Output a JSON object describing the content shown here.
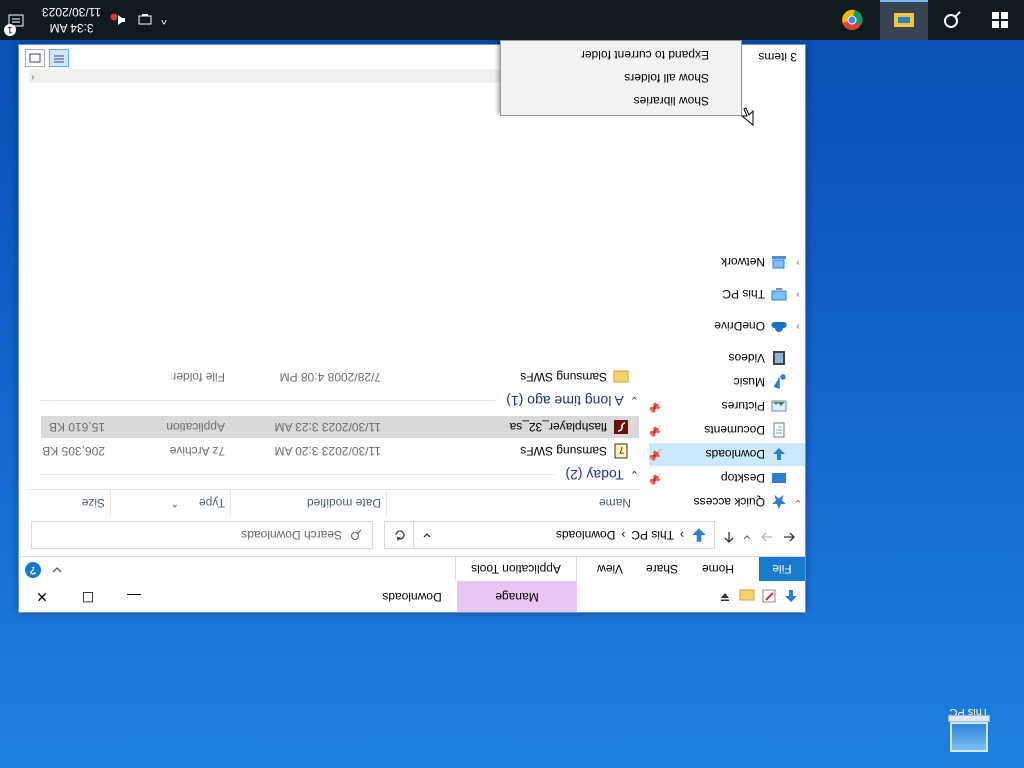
{
  "desktop": {
    "icon_label": "This PC"
  },
  "window": {
    "title": "Downloads",
    "contextual_tab": "Manage",
    "controls": {
      "minimize": "—",
      "maximize": "☐",
      "close": "✕"
    }
  },
  "ribbon": {
    "tabs": [
      "File",
      "Home",
      "Share",
      "View"
    ],
    "application_tools": "Application Tools",
    "help": "?"
  },
  "address": {
    "crumbs": [
      "This PC",
      "Downloads"
    ],
    "separator": "›",
    "search_placeholder": "Search Downloads"
  },
  "nav": {
    "items": [
      {
        "label": "Quick access",
        "icon": "star-icon"
      },
      {
        "label": "Desktop",
        "icon": "desktop-folder-icon"
      },
      {
        "label": "Downloads",
        "icon": "download-arrow-icon"
      },
      {
        "label": "Documents",
        "icon": "documents-icon"
      },
      {
        "label": "Pictures",
        "icon": "pictures-icon"
      },
      {
        "label": "Music",
        "icon": "music-icon"
      },
      {
        "label": "Videos",
        "icon": "videos-icon"
      },
      {
        "label": "OneDrive",
        "icon": "cloud-icon"
      },
      {
        "label": "This PC",
        "icon": "computer-icon"
      },
      {
        "label": "Network",
        "icon": "network-icon"
      }
    ]
  },
  "columns": {
    "name": "Name",
    "date": "Date modified",
    "type": "Type",
    "size": "Size"
  },
  "groups": [
    {
      "label": "Today (2)",
      "files": [
        {
          "name": "Samsung SWFs",
          "date": "11/30/2023 3:20 AM",
          "type": "7z Archive",
          "size": "206,305 KB",
          "icon": "archive-icon"
        },
        {
          "name": "flashplayer_32_sa",
          "date": "11/30/2023 3:23 AM",
          "type": "Application",
          "size": "15,610 KB",
          "icon": "flash-player-icon"
        }
      ]
    },
    {
      "label": "A long time ago (1)",
      "files": [
        {
          "name": "Samsung SWFs",
          "date": "7/28/2008 4:08 PM",
          "type": "File folder",
          "size": "",
          "icon": "folder-icon"
        }
      ]
    }
  ],
  "status": {
    "items_count": "3 items"
  },
  "context_menu": {
    "items": [
      "Show libraries",
      "Show all folders",
      "Expand to current folder"
    ]
  },
  "taskbar": {
    "time": "3:34 AM",
    "date": "11/30/2023",
    "notification_count": "1",
    "chevron": "^"
  },
  "colors": {
    "accent": "#1979ca",
    "manage_tab": "#e7c7f0",
    "selection": "#cce8ff",
    "group_text": "#1e3287",
    "taskbar": "#101820"
  }
}
